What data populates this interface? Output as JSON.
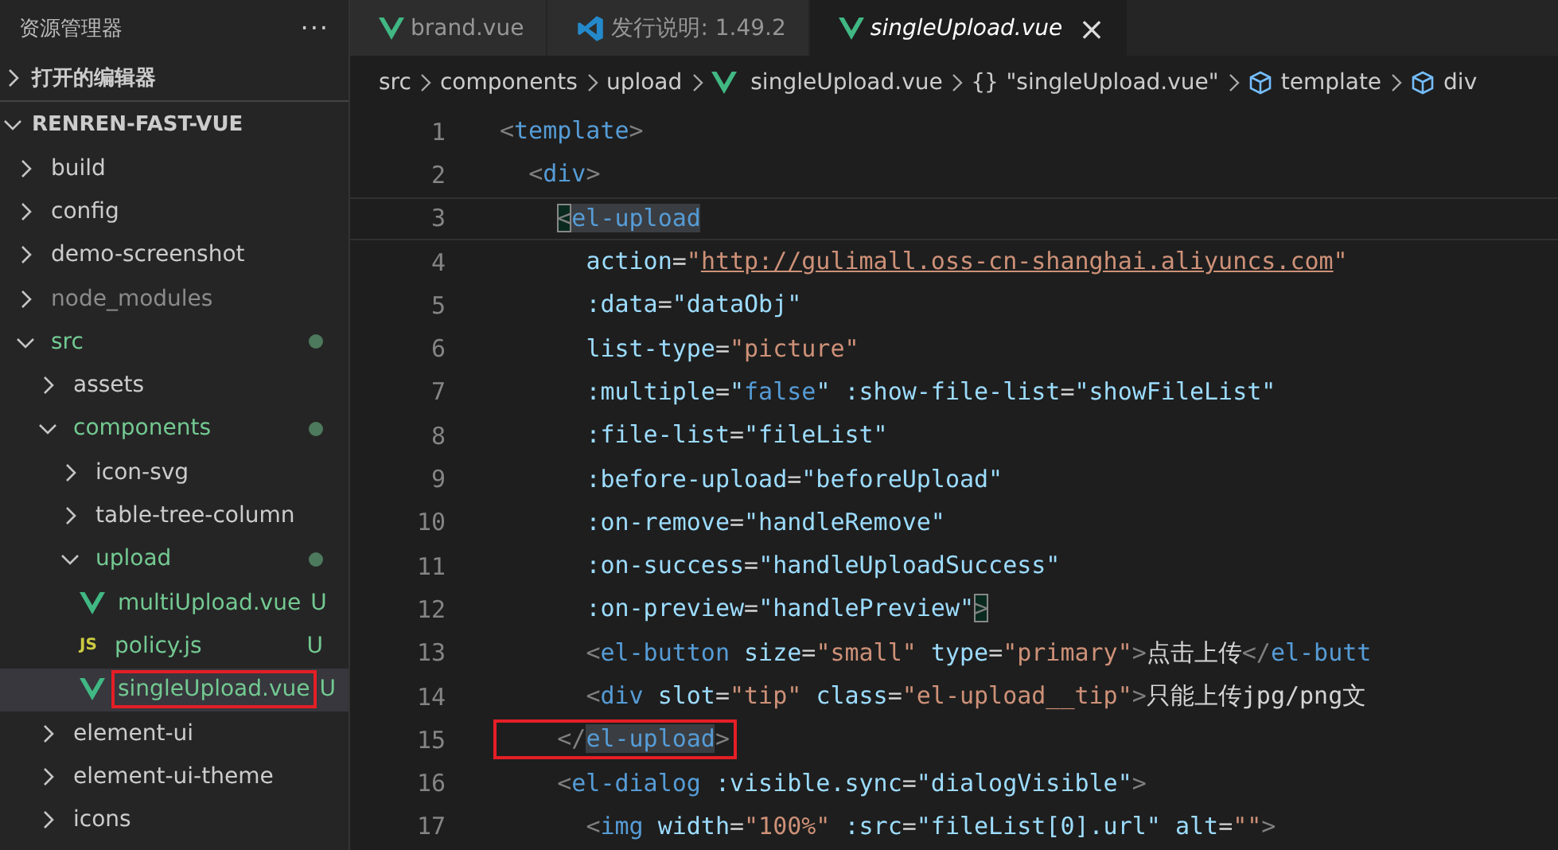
{
  "sidebar": {
    "title": "资源管理器",
    "more": "···",
    "sections": [
      {
        "label": "打开的编辑器",
        "expanded": false
      },
      {
        "label": "RENREN-FAST-VUE",
        "expanded": true
      }
    ],
    "tree": [
      {
        "name": "build",
        "kind": "folder",
        "expanded": false
      },
      {
        "name": "config",
        "kind": "folder",
        "expanded": false
      },
      {
        "name": "demo-screenshot",
        "kind": "folder",
        "expanded": false
      },
      {
        "name": "node_modules",
        "kind": "folder",
        "expanded": false,
        "ignored": true
      },
      {
        "name": "src",
        "kind": "folder",
        "expanded": true,
        "modified": true,
        "children": [
          {
            "name": "assets",
            "kind": "folder",
            "expanded": false
          },
          {
            "name": "components",
            "kind": "folder",
            "expanded": true,
            "modified": true,
            "children": [
              {
                "name": "icon-svg",
                "kind": "folder",
                "expanded": false
              },
              {
                "name": "table-tree-column",
                "kind": "folder",
                "expanded": false
              },
              {
                "name": "upload",
                "kind": "folder",
                "expanded": true,
                "modified": true,
                "children": [
                  {
                    "name": "multiUpload.vue",
                    "kind": "vue",
                    "modified": true,
                    "badge": "U",
                    "selected": false
                  },
                  {
                    "name": "policy.js",
                    "kind": "js",
                    "icon_text": "JS",
                    "modified": true,
                    "badge": "U",
                    "selected": false
                  },
                  {
                    "name": "singleUpload.vue",
                    "kind": "vue",
                    "modified": true,
                    "badge": "U",
                    "selected": true,
                    "highlighted": true
                  }
                ]
              }
            ]
          },
          {
            "name": "element-ui",
            "kind": "folder",
            "expanded": false
          },
          {
            "name": "element-ui-theme",
            "kind": "folder",
            "expanded": false
          },
          {
            "name": "icons",
            "kind": "folder",
            "expanded": false
          }
        ]
      }
    ]
  },
  "tabs": [
    {
      "label": "brand.vue",
      "kind": "vue",
      "selected": false,
      "preview": false
    },
    {
      "label": "发行说明: 1.49.2",
      "kind": "vscode",
      "selected": false,
      "preview": false
    },
    {
      "label": "singleUpload.vue",
      "kind": "vue",
      "selected": true,
      "preview": true,
      "close": "×"
    }
  ],
  "breadcrumbs": [
    {
      "label": "src",
      "kind": "text"
    },
    {
      "label": "components",
      "kind": "text"
    },
    {
      "label": "upload",
      "kind": "text"
    },
    {
      "label": "singleUpload.vue",
      "kind": "vue"
    },
    {
      "label": "\"singleUpload.vue\"",
      "kind": "braces",
      "icon_text": "{}"
    },
    {
      "label": "template",
      "kind": "symbol"
    },
    {
      "label": "div",
      "kind": "symbol"
    }
  ],
  "code": [
    {
      "n": "1",
      "tokens": [
        {
          "t": "<",
          "kind": "punct"
        },
        {
          "t": "template",
          "kind": "tag"
        },
        {
          "t": ">",
          "kind": "punct"
        }
      ]
    },
    {
      "n": "2",
      "tokens": [
        {
          "t": "  <",
          "kind": "punct"
        },
        {
          "t": "div",
          "kind": "tag"
        },
        {
          "t": ">",
          "kind": "punct"
        }
      ]
    },
    {
      "n": "3",
      "current": true,
      "tokens": [
        {
          "t": "    <",
          "kind": "punct",
          "bracket": true
        },
        {
          "t": "el-upload",
          "kind": "tag",
          "match": true
        }
      ]
    },
    {
      "n": "4",
      "tokens": [
        {
          "t": "      action",
          "kind": "attr"
        },
        {
          "t": "=",
          "kind": "text"
        },
        {
          "t": "\"",
          "kind": "str"
        },
        {
          "t": "http://gulimall.oss-cn-shanghai.aliyuncs.com",
          "kind": "link"
        },
        {
          "t": "\"",
          "kind": "str"
        }
      ]
    },
    {
      "n": "5",
      "tokens": [
        {
          "t": "      :data",
          "kind": "attr"
        },
        {
          "t": "=",
          "kind": "text"
        },
        {
          "t": "\"dataObj\"",
          "kind": "expr"
        }
      ]
    },
    {
      "n": "6",
      "tokens": [
        {
          "t": "      list-type",
          "kind": "attr"
        },
        {
          "t": "=",
          "kind": "text"
        },
        {
          "t": "\"picture\"",
          "kind": "str"
        }
      ]
    },
    {
      "n": "7",
      "tokens": [
        {
          "t": "      :multiple",
          "kind": "attr"
        },
        {
          "t": "=",
          "kind": "text"
        },
        {
          "t": "\"",
          "kind": "expr"
        },
        {
          "t": "false",
          "kind": "bool"
        },
        {
          "t": "\"",
          "kind": "expr"
        },
        {
          "t": " :show-file-list",
          "kind": "attr"
        },
        {
          "t": "=",
          "kind": "text"
        },
        {
          "t": "\"showFileList\"",
          "kind": "expr"
        }
      ]
    },
    {
      "n": "8",
      "tokens": [
        {
          "t": "      :file-list",
          "kind": "attr"
        },
        {
          "t": "=",
          "kind": "text"
        },
        {
          "t": "\"fileList\"",
          "kind": "expr"
        }
      ]
    },
    {
      "n": "9",
      "tokens": [
        {
          "t": "      :before-upload",
          "kind": "attr"
        },
        {
          "t": "=",
          "kind": "text"
        },
        {
          "t": "\"beforeUpload\"",
          "kind": "expr"
        }
      ]
    },
    {
      "n": "10",
      "tokens": [
        {
          "t": "      :on-remove",
          "kind": "attr"
        },
        {
          "t": "=",
          "kind": "text"
        },
        {
          "t": "\"handleRemove\"",
          "kind": "expr"
        }
      ]
    },
    {
      "n": "11",
      "tokens": [
        {
          "t": "      :on-success",
          "kind": "attr"
        },
        {
          "t": "=",
          "kind": "text"
        },
        {
          "t": "\"handleUploadSuccess\"",
          "kind": "expr"
        }
      ]
    },
    {
      "n": "12",
      "tokens": [
        {
          "t": "      :on-preview",
          "kind": "attr"
        },
        {
          "t": "=",
          "kind": "text"
        },
        {
          "t": "\"handlePreview\"",
          "kind": "expr"
        },
        {
          "t": ">",
          "kind": "punct",
          "bracket": true
        }
      ]
    },
    {
      "n": "13",
      "tokens": [
        {
          "t": "      <",
          "kind": "punct"
        },
        {
          "t": "el-button",
          "kind": "tag"
        },
        {
          "t": " size",
          "kind": "attr"
        },
        {
          "t": "=",
          "kind": "text"
        },
        {
          "t": "\"small\"",
          "kind": "str"
        },
        {
          "t": " type",
          "kind": "attr"
        },
        {
          "t": "=",
          "kind": "text"
        },
        {
          "t": "\"primary\"",
          "kind": "str"
        },
        {
          "t": ">",
          "kind": "punct"
        },
        {
          "t": "点击上传",
          "kind": "text"
        },
        {
          "t": "</",
          "kind": "punct"
        },
        {
          "t": "el-butt",
          "kind": "tag"
        }
      ]
    },
    {
      "n": "14",
      "tokens": [
        {
          "t": "      <",
          "kind": "punct"
        },
        {
          "t": "div",
          "kind": "tag"
        },
        {
          "t": " slot",
          "kind": "attr"
        },
        {
          "t": "=",
          "kind": "text"
        },
        {
          "t": "\"tip\"",
          "kind": "str"
        },
        {
          "t": " class",
          "kind": "attr"
        },
        {
          "t": "=",
          "kind": "text"
        },
        {
          "t": "\"el-upload__tip\"",
          "kind": "str"
        },
        {
          "t": ">",
          "kind": "punct"
        },
        {
          "t": "只能上传jpg/png文",
          "kind": "text"
        }
      ]
    },
    {
      "n": "15",
      "highlighted": true,
      "tokens": [
        {
          "t": "    </",
          "kind": "punct"
        },
        {
          "t": "el-upload",
          "kind": "tag",
          "match": true
        },
        {
          "t": ">",
          "kind": "punct"
        }
      ]
    },
    {
      "n": "16",
      "tokens": [
        {
          "t": "    <",
          "kind": "punct"
        },
        {
          "t": "el-dialog",
          "kind": "tag"
        },
        {
          "t": " :visible.sync",
          "kind": "attr"
        },
        {
          "t": "=",
          "kind": "text"
        },
        {
          "t": "\"dialogVisible\"",
          "kind": "expr"
        },
        {
          "t": ">",
          "kind": "punct"
        }
      ]
    },
    {
      "n": "17",
      "tokens": [
        {
          "t": "      <",
          "kind": "punct"
        },
        {
          "t": "img",
          "kind": "tag"
        },
        {
          "t": " width",
          "kind": "attr"
        },
        {
          "t": "=",
          "kind": "text"
        },
        {
          "t": "\"100%\"",
          "kind": "str"
        },
        {
          "t": " :src",
          "kind": "attr"
        },
        {
          "t": "=",
          "kind": "text"
        },
        {
          "t": "\"fileList[0].url\"",
          "kind": "expr"
        },
        {
          "t": " alt",
          "kind": "attr"
        },
        {
          "t": "=",
          "kind": "text"
        },
        {
          "t": "\"\"",
          "kind": "str"
        },
        {
          "t": ">",
          "kind": "punct"
        }
      ]
    }
  ]
}
